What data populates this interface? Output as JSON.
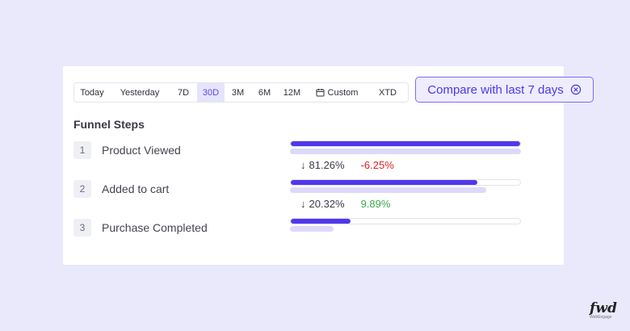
{
  "date_range": {
    "options": [
      {
        "label": "Today",
        "width": 44
      },
      {
        "label": "Yesterday",
        "width": 74
      },
      {
        "label": "7D",
        "width": 34
      },
      {
        "label": "30D",
        "width": 34,
        "active": true
      },
      {
        "label": "3M",
        "width": 33
      },
      {
        "label": "6M",
        "width": 33
      },
      {
        "label": "12M",
        "width": 35
      },
      {
        "label": "Custom",
        "width": 76,
        "icon": "calendar-icon"
      },
      {
        "label": "XTD",
        "width": 50
      }
    ]
  },
  "compare": {
    "label": "Compare with last 7 days",
    "icon": "close-circle-icon"
  },
  "funnel": {
    "title": "Funnel Steps",
    "steps": [
      {
        "number": "1",
        "label": "Product Viewed",
        "value_pct": 100,
        "compare_pct": 100
      },
      {
        "number": "2",
        "label": "Added to cart",
        "value_pct": 81.3,
        "compare_pct": 84.8
      },
      {
        "number": "3",
        "label": "Purchase Completed",
        "value_pct": 26,
        "compare_pct": 19
      }
    ],
    "conversions": [
      {
        "arrow": "↓",
        "rate": "81.26%",
        "delta": "-6.25%",
        "delta_color": "#e0202a"
      },
      {
        "arrow": "↓",
        "rate": "20.32%",
        "delta": "9.89%",
        "delta_color": "#3aa84a"
      }
    ]
  },
  "colors": {
    "accent": "#4f37ec",
    "compare_bar": "#ddd9fa",
    "background": "#e9e9fb"
  },
  "brand": {
    "logo_text": "fwd",
    "logo_sub": "WebEngage"
  }
}
